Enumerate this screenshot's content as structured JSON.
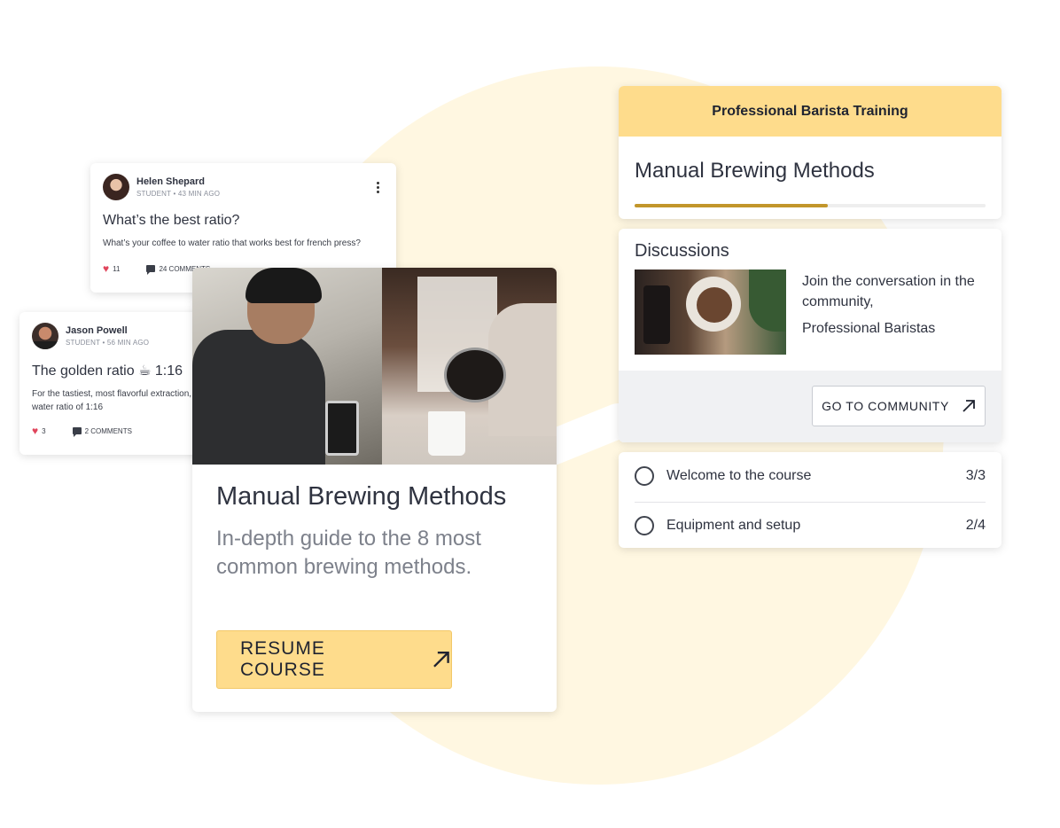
{
  "posts": [
    {
      "author": "Helen Shepard",
      "meta": "STUDENT • 43 MIN AGO",
      "title": "What’s the best ratio?",
      "body": "What’s your coffee to water ratio that works best for french press?",
      "likes": "11",
      "comments": "24 COMMENTS"
    },
    {
      "author": "Jason Powell",
      "meta": "STUDENT • 56 MIN AGO",
      "title": "The golden ratio ☕ 1:16",
      "body": "For the tastiest, most flavorful extraction, use a coffee to water ratio of 1:16",
      "likes": "3",
      "comments": "2 COMMENTS"
    }
  ],
  "course_card": {
    "title": "Manual Brewing Methods",
    "subtitle": "In-depth guide to the 8 most common brewing methods.",
    "resume_label": "RESUME COURSE"
  },
  "panel": {
    "program": "Professional Barista Training",
    "course_title": "Manual Brewing Methods",
    "progress": 0.55,
    "discussions": {
      "title": "Discussions",
      "text": "Join the conversation in the community,",
      "community": "Professional Baristas",
      "button_label": "GO TO COMMUNITY"
    },
    "lessons": [
      {
        "label": "Welcome to the course",
        "count": "3/3"
      },
      {
        "label": "Equipment and setup",
        "count": "2/4"
      }
    ]
  },
  "colors": {
    "accent": "#fedc8c",
    "progress": "#c2962b",
    "background_circle": "#fff7e1"
  },
  "icons": [
    "kebab-menu-icon",
    "heart-icon",
    "comment-icon",
    "arrow-up-right-icon",
    "circle-icon"
  ]
}
